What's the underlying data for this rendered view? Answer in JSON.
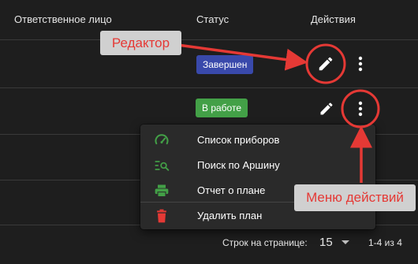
{
  "table": {
    "headers": {
      "responsible": "Ответственное лицо",
      "status": "Статус",
      "actions": "Действия"
    },
    "rows": [
      {
        "status": "Завершен",
        "status_color": "#3949ab"
      },
      {
        "status": "В работе",
        "status_color": "#43a047"
      }
    ]
  },
  "menu": {
    "items": [
      {
        "label": "Список приборов",
        "icon": "gauge-icon",
        "color": "#43a047"
      },
      {
        "label": "Поиск по Аршину",
        "icon": "list-search-icon",
        "color": "#43a047"
      },
      {
        "label": "Отчет о плане",
        "icon": "printer-icon",
        "color": "#43a047"
      },
      {
        "label": "Удалить план",
        "icon": "trash-icon",
        "color": "#e53935"
      }
    ]
  },
  "pagination": {
    "rows_per_page_label": "Строк на странице:",
    "rows_per_page": "15",
    "range": "1-4 из 4"
  },
  "annotations": {
    "editor": "Редактор",
    "actions_menu": "Меню действий",
    "color": "#e53935"
  }
}
